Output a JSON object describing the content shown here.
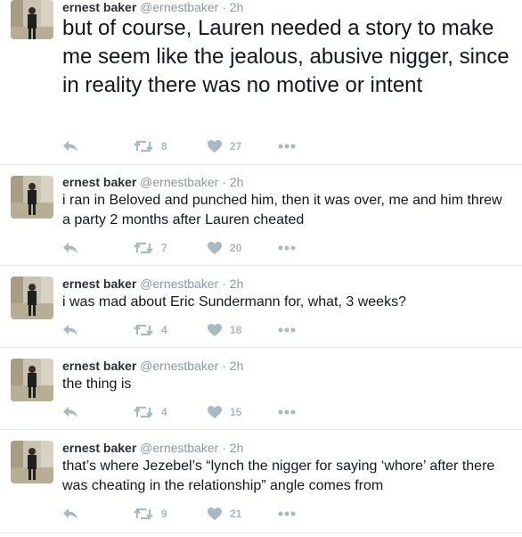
{
  "colors": {
    "name": "#292f33",
    "meta": "#8899a6",
    "icon": "#aab8c2",
    "text": "#14171a",
    "divider": "#e1e8ed"
  },
  "tweets": [
    {
      "name": "ernest baker",
      "handle": "@ernestbaker",
      "dot": "·",
      "time": "2h",
      "text": "but of course, Lauren needed a story to make me seem like the jealous, abusive nigger, since in reality there was no motive or intent",
      "retweets": "8",
      "likes": "27"
    },
    {
      "name": "ernest baker",
      "handle": "@ernestbaker",
      "dot": "·",
      "time": "2h",
      "text": "i ran in Beloved and punched him, then it was over, me and him threw a party 2 months after Lauren cheated",
      "retweets": "7",
      "likes": "20"
    },
    {
      "name": "ernest baker",
      "handle": "@ernestbaker",
      "dot": "·",
      "time": "2h",
      "text": "i was mad about Eric Sundermann for, what, 3 weeks?",
      "retweets": "4",
      "likes": "18"
    },
    {
      "name": "ernest baker",
      "handle": "@ernestbaker",
      "dot": "·",
      "time": "2h",
      "text": "the thing is",
      "retweets": "4",
      "likes": "15"
    },
    {
      "name": "ernest baker",
      "handle": "@ernestbaker",
      "dot": "·",
      "time": "2h",
      "text": "that’s where Jezebel’s “lynch the nigger for saying ‘whore’ after there was cheating in the relationship” angle comes from",
      "retweets": "9",
      "likes": "21"
    }
  ]
}
